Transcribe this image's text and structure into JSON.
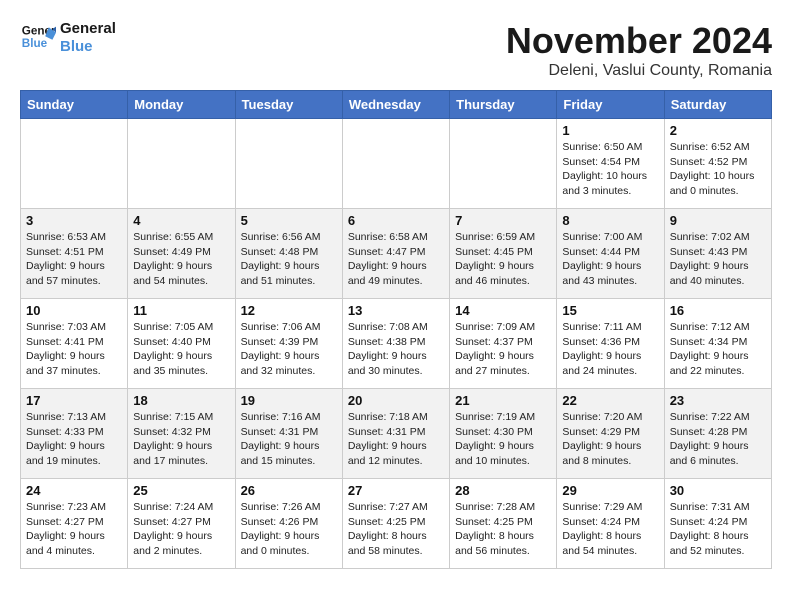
{
  "logo": {
    "line1": "General",
    "line2": "Blue"
  },
  "title": "November 2024",
  "location": "Deleni, Vaslui County, Romania",
  "weekdays": [
    "Sunday",
    "Monday",
    "Tuesday",
    "Wednesday",
    "Thursday",
    "Friday",
    "Saturday"
  ],
  "weeks": [
    [
      {
        "day": "",
        "info": ""
      },
      {
        "day": "",
        "info": ""
      },
      {
        "day": "",
        "info": ""
      },
      {
        "day": "",
        "info": ""
      },
      {
        "day": "",
        "info": ""
      },
      {
        "day": "1",
        "info": "Sunrise: 6:50 AM\nSunset: 4:54 PM\nDaylight: 10 hours and 3 minutes."
      },
      {
        "day": "2",
        "info": "Sunrise: 6:52 AM\nSunset: 4:52 PM\nDaylight: 10 hours and 0 minutes."
      }
    ],
    [
      {
        "day": "3",
        "info": "Sunrise: 6:53 AM\nSunset: 4:51 PM\nDaylight: 9 hours and 57 minutes."
      },
      {
        "day": "4",
        "info": "Sunrise: 6:55 AM\nSunset: 4:49 PM\nDaylight: 9 hours and 54 minutes."
      },
      {
        "day": "5",
        "info": "Sunrise: 6:56 AM\nSunset: 4:48 PM\nDaylight: 9 hours and 51 minutes."
      },
      {
        "day": "6",
        "info": "Sunrise: 6:58 AM\nSunset: 4:47 PM\nDaylight: 9 hours and 49 minutes."
      },
      {
        "day": "7",
        "info": "Sunrise: 6:59 AM\nSunset: 4:45 PM\nDaylight: 9 hours and 46 minutes."
      },
      {
        "day": "8",
        "info": "Sunrise: 7:00 AM\nSunset: 4:44 PM\nDaylight: 9 hours and 43 minutes."
      },
      {
        "day": "9",
        "info": "Sunrise: 7:02 AM\nSunset: 4:43 PM\nDaylight: 9 hours and 40 minutes."
      }
    ],
    [
      {
        "day": "10",
        "info": "Sunrise: 7:03 AM\nSunset: 4:41 PM\nDaylight: 9 hours and 37 minutes."
      },
      {
        "day": "11",
        "info": "Sunrise: 7:05 AM\nSunset: 4:40 PM\nDaylight: 9 hours and 35 minutes."
      },
      {
        "day": "12",
        "info": "Sunrise: 7:06 AM\nSunset: 4:39 PM\nDaylight: 9 hours and 32 minutes."
      },
      {
        "day": "13",
        "info": "Sunrise: 7:08 AM\nSunset: 4:38 PM\nDaylight: 9 hours and 30 minutes."
      },
      {
        "day": "14",
        "info": "Sunrise: 7:09 AM\nSunset: 4:37 PM\nDaylight: 9 hours and 27 minutes."
      },
      {
        "day": "15",
        "info": "Sunrise: 7:11 AM\nSunset: 4:36 PM\nDaylight: 9 hours and 24 minutes."
      },
      {
        "day": "16",
        "info": "Sunrise: 7:12 AM\nSunset: 4:34 PM\nDaylight: 9 hours and 22 minutes."
      }
    ],
    [
      {
        "day": "17",
        "info": "Sunrise: 7:13 AM\nSunset: 4:33 PM\nDaylight: 9 hours and 19 minutes."
      },
      {
        "day": "18",
        "info": "Sunrise: 7:15 AM\nSunset: 4:32 PM\nDaylight: 9 hours and 17 minutes."
      },
      {
        "day": "19",
        "info": "Sunrise: 7:16 AM\nSunset: 4:31 PM\nDaylight: 9 hours and 15 minutes."
      },
      {
        "day": "20",
        "info": "Sunrise: 7:18 AM\nSunset: 4:31 PM\nDaylight: 9 hours and 12 minutes."
      },
      {
        "day": "21",
        "info": "Sunrise: 7:19 AM\nSunset: 4:30 PM\nDaylight: 9 hours and 10 minutes."
      },
      {
        "day": "22",
        "info": "Sunrise: 7:20 AM\nSunset: 4:29 PM\nDaylight: 9 hours and 8 minutes."
      },
      {
        "day": "23",
        "info": "Sunrise: 7:22 AM\nSunset: 4:28 PM\nDaylight: 9 hours and 6 minutes."
      }
    ],
    [
      {
        "day": "24",
        "info": "Sunrise: 7:23 AM\nSunset: 4:27 PM\nDaylight: 9 hours and 4 minutes."
      },
      {
        "day": "25",
        "info": "Sunrise: 7:24 AM\nSunset: 4:27 PM\nDaylight: 9 hours and 2 minutes."
      },
      {
        "day": "26",
        "info": "Sunrise: 7:26 AM\nSunset: 4:26 PM\nDaylight: 9 hours and 0 minutes."
      },
      {
        "day": "27",
        "info": "Sunrise: 7:27 AM\nSunset: 4:25 PM\nDaylight: 8 hours and 58 minutes."
      },
      {
        "day": "28",
        "info": "Sunrise: 7:28 AM\nSunset: 4:25 PM\nDaylight: 8 hours and 56 minutes."
      },
      {
        "day": "29",
        "info": "Sunrise: 7:29 AM\nSunset: 4:24 PM\nDaylight: 8 hours and 54 minutes."
      },
      {
        "day": "30",
        "info": "Sunrise: 7:31 AM\nSunset: 4:24 PM\nDaylight: 8 hours and 52 minutes."
      }
    ]
  ]
}
